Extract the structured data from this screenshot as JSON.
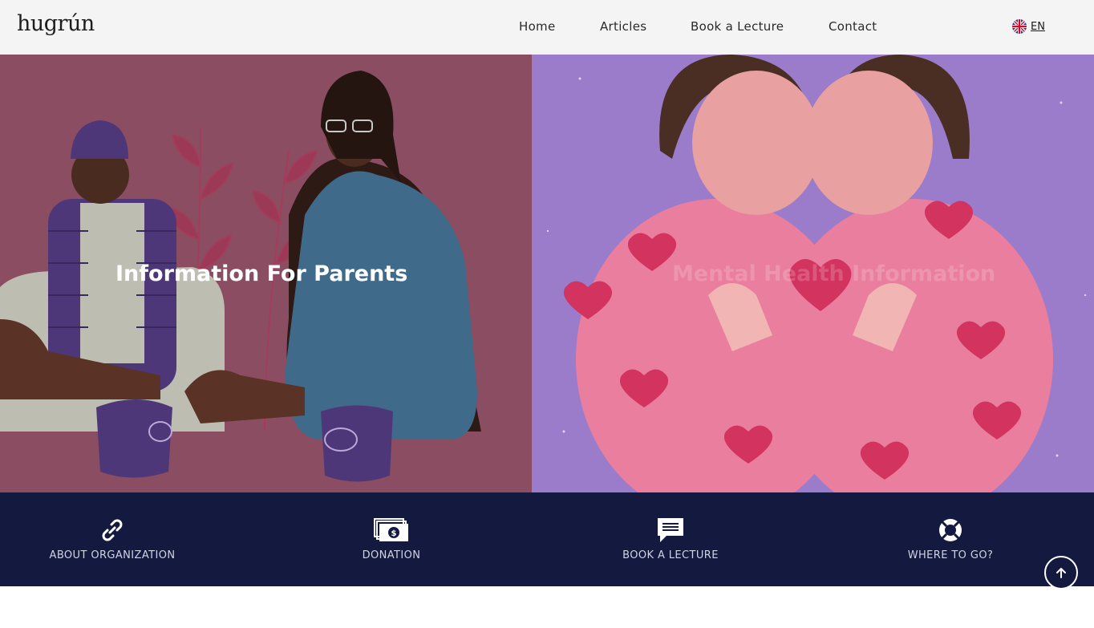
{
  "brand": {
    "logo_text": "hugrún"
  },
  "nav": {
    "items": [
      {
        "label": "Home"
      },
      {
        "label": "Articles"
      },
      {
        "label": "Book a Lecture"
      },
      {
        "label": "Contact"
      }
    ]
  },
  "language": {
    "label": "EN",
    "icon": "uk-flag-icon"
  },
  "hero": {
    "left": {
      "title": "Information For Parents",
      "color": "#8a4d62"
    },
    "right": {
      "title": "Mental Health Information",
      "color": "#9a7ccb"
    }
  },
  "features": [
    {
      "label": "ABOUT ORGANIZATION",
      "icon": "link-icon"
    },
    {
      "label": "DONATION",
      "icon": "money-icon"
    },
    {
      "label": "BOOK A LECTURE",
      "icon": "chat-icon"
    },
    {
      "label": "WHERE TO GO?",
      "icon": "lifebuoy-icon"
    }
  ],
  "colors": {
    "footer_bg": "#141a3f",
    "header_bg": "#f4f4f4"
  }
}
